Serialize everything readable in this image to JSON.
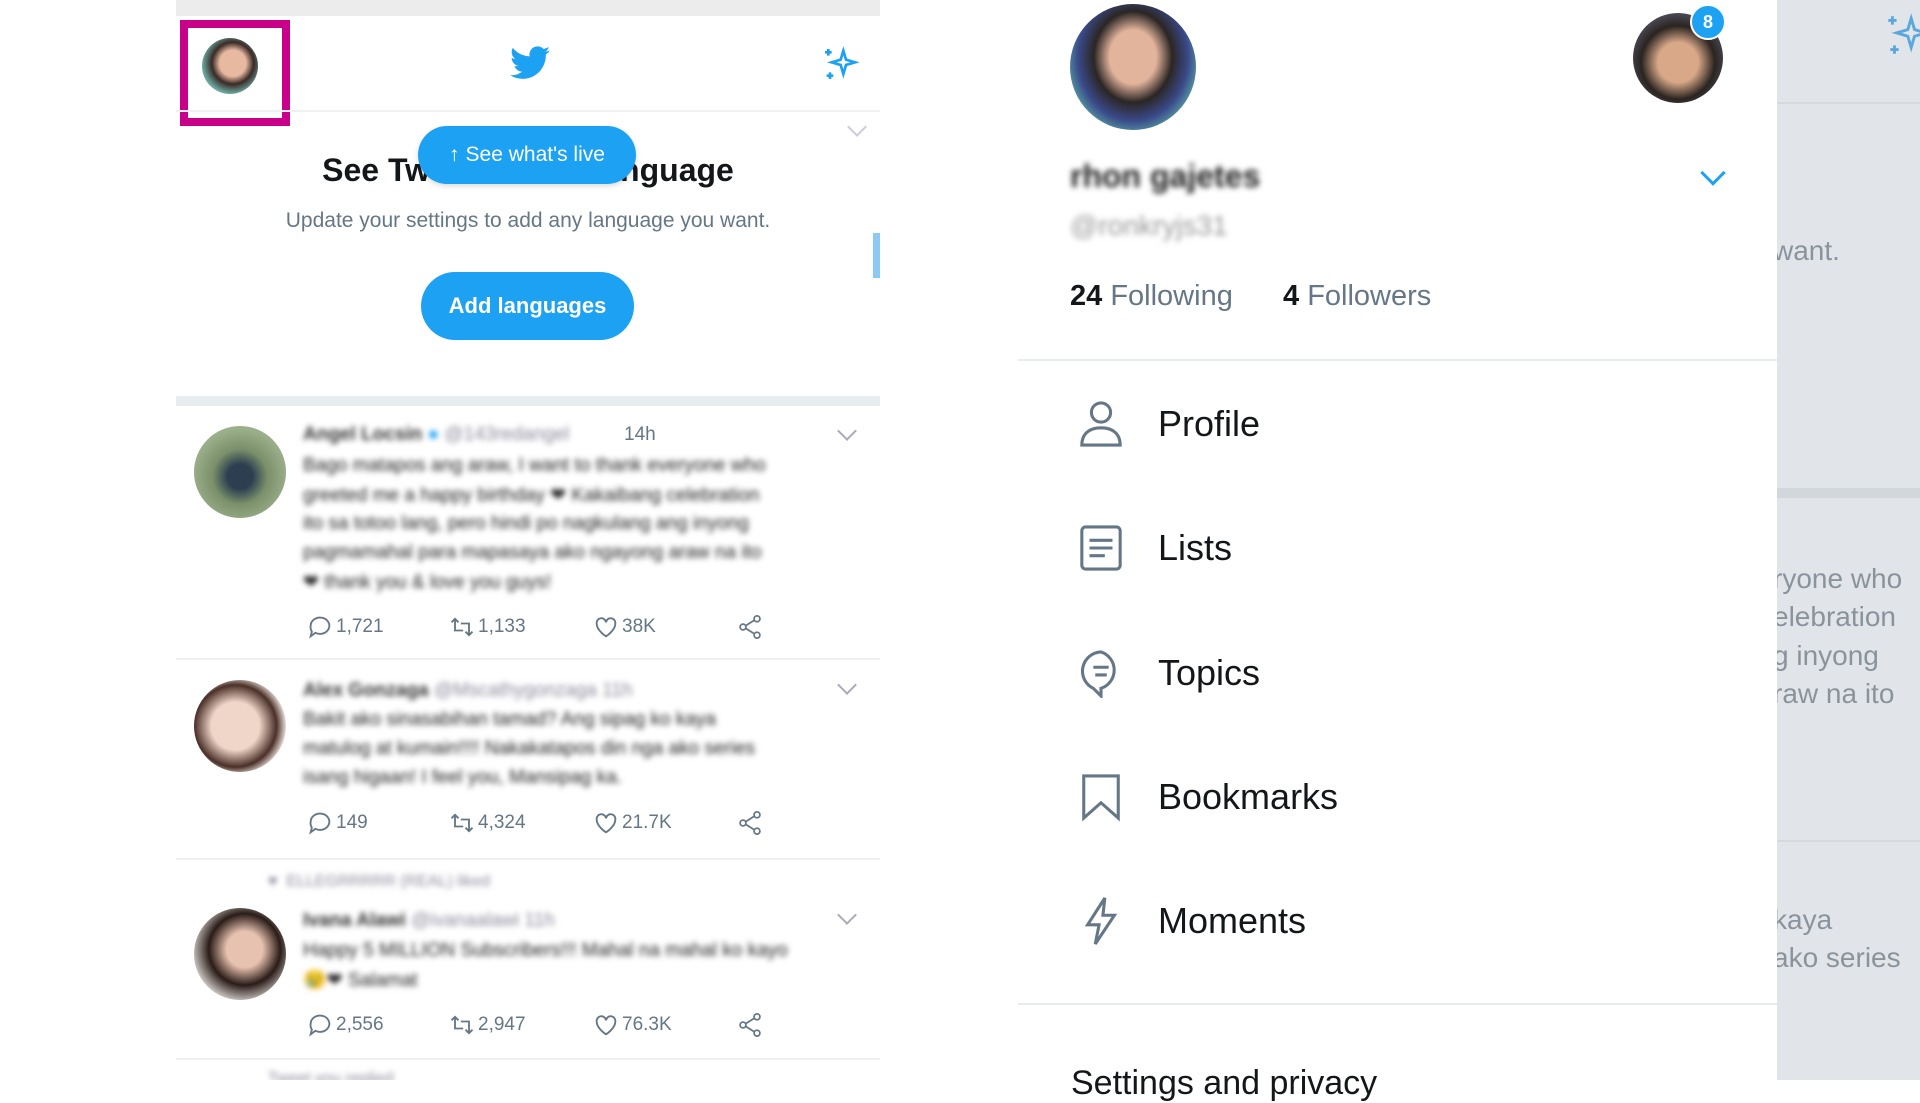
{
  "feed": {
    "language_card": {
      "title_left": "See Tw",
      "title_right": "nguage",
      "subtitle": "Update your settings to add any language you want.",
      "add_button": "Add languages"
    },
    "live_pill": "See what's live",
    "tweets": [
      {
        "name": "Angel Locsin",
        "handle": "@143redangel",
        "time": "14h",
        "lines": [
          "Bago matapos ang araw, I want to thank everyone who",
          "greeted me a happy birthday ❤ Kakaibang celebration",
          "ito sa totoo lang, pero hindi po nagkulang ang inyong",
          "pagmamahal para mapasaya ako ngayong araw na ito",
          "❤ thank you & love you guys!"
        ],
        "replies": "1,721",
        "retweets": "1,133",
        "likes": "38K"
      },
      {
        "name": "Alex Gonzaga",
        "handle": "@Mscathygonzaga",
        "time": "11h",
        "lines": [
          "Bakit ako sinasabihan tamad? Ang sipag ko kaya",
          "matulog at kumain!!!! Nakakatapos din nga ako series",
          "isang higaan! I feel you, Mansipag ka."
        ],
        "replies": "149",
        "retweets": "4,324",
        "likes": "21.7K"
      },
      {
        "context": "ELLEGRRRRR (REAL) liked",
        "name": "Ivana Alawi",
        "handle": "@ivanaalawi",
        "time": "11h",
        "lines": [
          "Happy 5 MILLION Subscribers!!! Mahal na mahal ko kayo",
          "😢❤ Salamat"
        ],
        "replies": "2,556",
        "retweets": "2,947",
        "likes": "76.3K"
      }
    ],
    "next_context": "Tweet you replied"
  },
  "drawer": {
    "name": "rhon gajetes",
    "handle": "@ronkryjs31",
    "following_count": "24",
    "following_label": "Following",
    "followers_count": "4",
    "followers_label": "Followers",
    "notification_badge": "8",
    "menu": [
      {
        "label": "Profile",
        "icon": "person-icon"
      },
      {
        "label": "Lists",
        "icon": "list-icon"
      },
      {
        "label": "Topics",
        "icon": "topics-icon"
      },
      {
        "label": "Bookmarks",
        "icon": "bookmark-icon"
      },
      {
        "label": "Moments",
        "icon": "lightning-icon"
      }
    ],
    "settings": "Settings and privacy"
  },
  "shade_text": [
    "want.",
    "ryone who",
    "elebration",
    "g inyong",
    "raw na ito",
    "kaya",
    "ako series"
  ],
  "colors": {
    "accent": "#1da1f2",
    "highlight": "#c9008a",
    "shade": "#e1e5ea"
  }
}
